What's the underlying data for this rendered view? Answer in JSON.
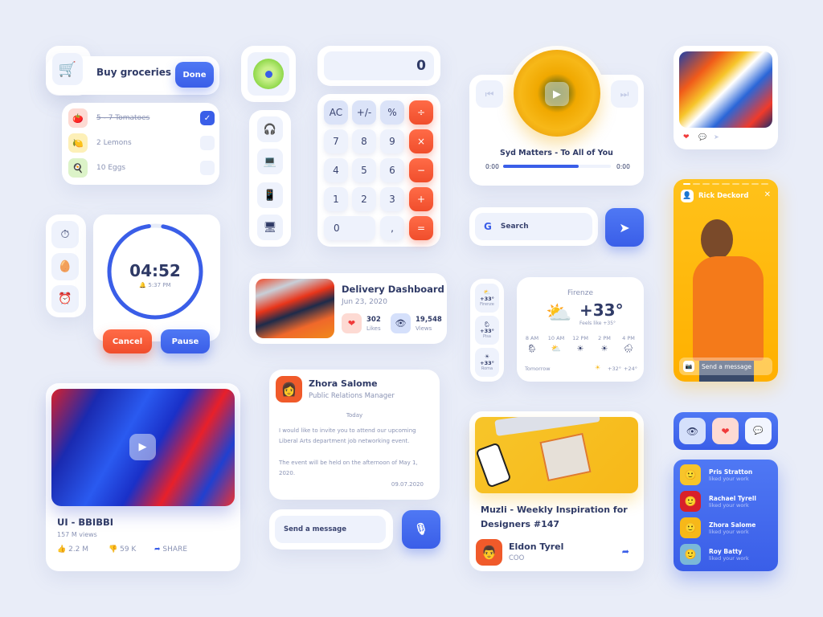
{
  "colors": {
    "background": "#e9edf8",
    "accent_blue": "#3a5ee8",
    "accent_red": "#f04e2c",
    "text_dark": "#2f3a66",
    "text_muted": "#8a93b4"
  },
  "groceries": {
    "title": "Buy groceries",
    "done_label": "Done",
    "cart_icon": "🛒",
    "items": [
      {
        "label": "5 - 7 Tomatoes",
        "icon": "🍅",
        "checked": true
      },
      {
        "label": "2 Lemons",
        "icon": "🍋",
        "checked": false
      },
      {
        "label": "10 Eggs",
        "icon": "🍳",
        "checked": false
      }
    ]
  },
  "devices": {
    "locator_icon": "📍",
    "items": [
      {
        "name": "airpods",
        "icon": "🎧"
      },
      {
        "name": "laptop",
        "icon": "💻"
      },
      {
        "name": "phone",
        "icon": "📱"
      },
      {
        "name": "mac-mini",
        "icon": "🖥"
      }
    ]
  },
  "calculator": {
    "display": "0",
    "keys": [
      [
        "AC",
        "+/-",
        "%",
        "÷"
      ],
      [
        "7",
        "8",
        "9",
        "×"
      ],
      [
        "4",
        "5",
        "6",
        "−"
      ],
      [
        "1",
        "2",
        "3",
        "+"
      ],
      [
        "0",
        ",",
        "="
      ]
    ]
  },
  "music": {
    "title": "Syd Matters - To All of You",
    "time_start": "0:00",
    "time_end": "0:00",
    "progress": 0.7,
    "prev_icon": "⏮",
    "next_icon": "⏭",
    "play_icon": "▶"
  },
  "post": {
    "like_icon": "❤",
    "comment_icon": "💬",
    "share_icon": "➤"
  },
  "timer": {
    "time": "04:52",
    "alarm": "5:37 PM",
    "progress": 0.95,
    "side_icons": [
      "⏱",
      "🥚",
      "⏰"
    ],
    "cancel_label": "Cancel",
    "pause_label": "Pause"
  },
  "delivery": {
    "title": "Delivery Dashboard",
    "date": "Jun 23, 2020",
    "likes_value": "302",
    "likes_label": "Likes",
    "views_value": "19,548",
    "views_label": "Views"
  },
  "search": {
    "placeholder": "Search",
    "google_glyph": "G",
    "send_icon": "➤"
  },
  "weather": {
    "cities": [
      {
        "temp": "+33°",
        "name": "Firenze",
        "icon": "⛅"
      },
      {
        "temp": "+33°",
        "name": "Pisa",
        "icon": "🌦"
      },
      {
        "temp": "+33°",
        "name": "Roma",
        "icon": "☀"
      }
    ],
    "city": "Firenze",
    "temp": "+33°",
    "feels": "Feels like +35°",
    "main_icon": "⛅",
    "hours": [
      {
        "time": "8 AM",
        "icon": "🌦"
      },
      {
        "time": "10 AM",
        "icon": "⛅"
      },
      {
        "time": "12 PM",
        "icon": "☀"
      },
      {
        "time": "2 PM",
        "icon": "☀"
      },
      {
        "time": "4 PM",
        "icon": "🌧"
      }
    ],
    "tomorrow_label": "Tomorrow",
    "tomorrow_icon": "☀",
    "tomorrow_high": "+32°",
    "tomorrow_low": "+24°"
  },
  "story": {
    "name": "Rick Deckord",
    "close_icon": "✕",
    "message_placeholder": "Send a message",
    "segments": 9,
    "active_segment": 1
  },
  "video": {
    "title": "UI - BBIBBI",
    "views": "157 M views",
    "likes": "2.2 M",
    "dislikes": "59 K",
    "share_label": "SHARE"
  },
  "chat": {
    "name": "Zhora Salome",
    "role": "Public Relations Manager",
    "day": "Today",
    "message_1": "I would like to invite you to attend our upcoming Liberal Arts department job networking event.",
    "message_2": "The event will be held on the afternoon of May 1, 2020.",
    "date": "09.07.2020",
    "input_placeholder": "Send a message",
    "mic_icon": "🎙"
  },
  "article": {
    "title": "Muzli - Weekly Inspiration for Designers #147",
    "author": "Eldon Tyrel",
    "author_role": "COO",
    "share_icon": "➦"
  },
  "likes_panel": {
    "tabs": [
      {
        "name": "views",
        "icon": "👁"
      },
      {
        "name": "likes",
        "icon": "❤"
      },
      {
        "name": "comments",
        "icon": "💬"
      }
    ],
    "people": [
      {
        "name": "Pris Stratton",
        "action": "liked your work"
      },
      {
        "name": "Rachael Tyrell",
        "action": "liked your work"
      },
      {
        "name": "Zhora Salome",
        "action": "liked your work"
      },
      {
        "name": "Roy Batty",
        "action": "liked your work"
      }
    ]
  }
}
